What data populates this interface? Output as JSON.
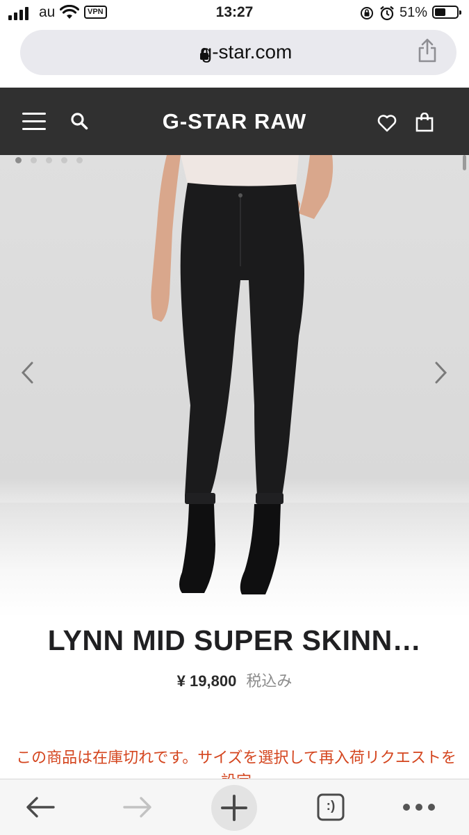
{
  "status_bar": {
    "carrier": "au",
    "vpn_label": "VPN",
    "time": "13:27",
    "battery_percent": "51%",
    "battery_level": 0.51,
    "icons": [
      "signal-icon",
      "wifi-icon",
      "rotation-lock-icon",
      "alarm-icon",
      "battery-icon"
    ]
  },
  "browser": {
    "url_domain": "g-star.com",
    "icons": [
      "padlock-icon",
      "share-icon"
    ]
  },
  "site_header": {
    "logo": "G-STAR RAW",
    "icons": [
      "menu-icon",
      "search-icon",
      "heart-icon",
      "bag-icon"
    ],
    "background_color": "#303030"
  },
  "gallery": {
    "slide_count": 5,
    "active_slide": 1,
    "icons": [
      "chevron-left-icon",
      "chevron-right-icon"
    ]
  },
  "product": {
    "title": "LYNN MID SUPER SKINN…",
    "price": "¥ 19,800",
    "tax_note": "税込み",
    "out_of_stock_message": "この商品は在庫切れです。サイズを選択して再入荷リクエストを設定",
    "alert_color": "#d4451e"
  },
  "toolbar": {
    "icons": [
      "back-arrow-icon",
      "forward-arrow-icon",
      "plus-icon",
      "tabs-icon",
      "more-icon"
    ],
    "tabs_label": ":)"
  }
}
